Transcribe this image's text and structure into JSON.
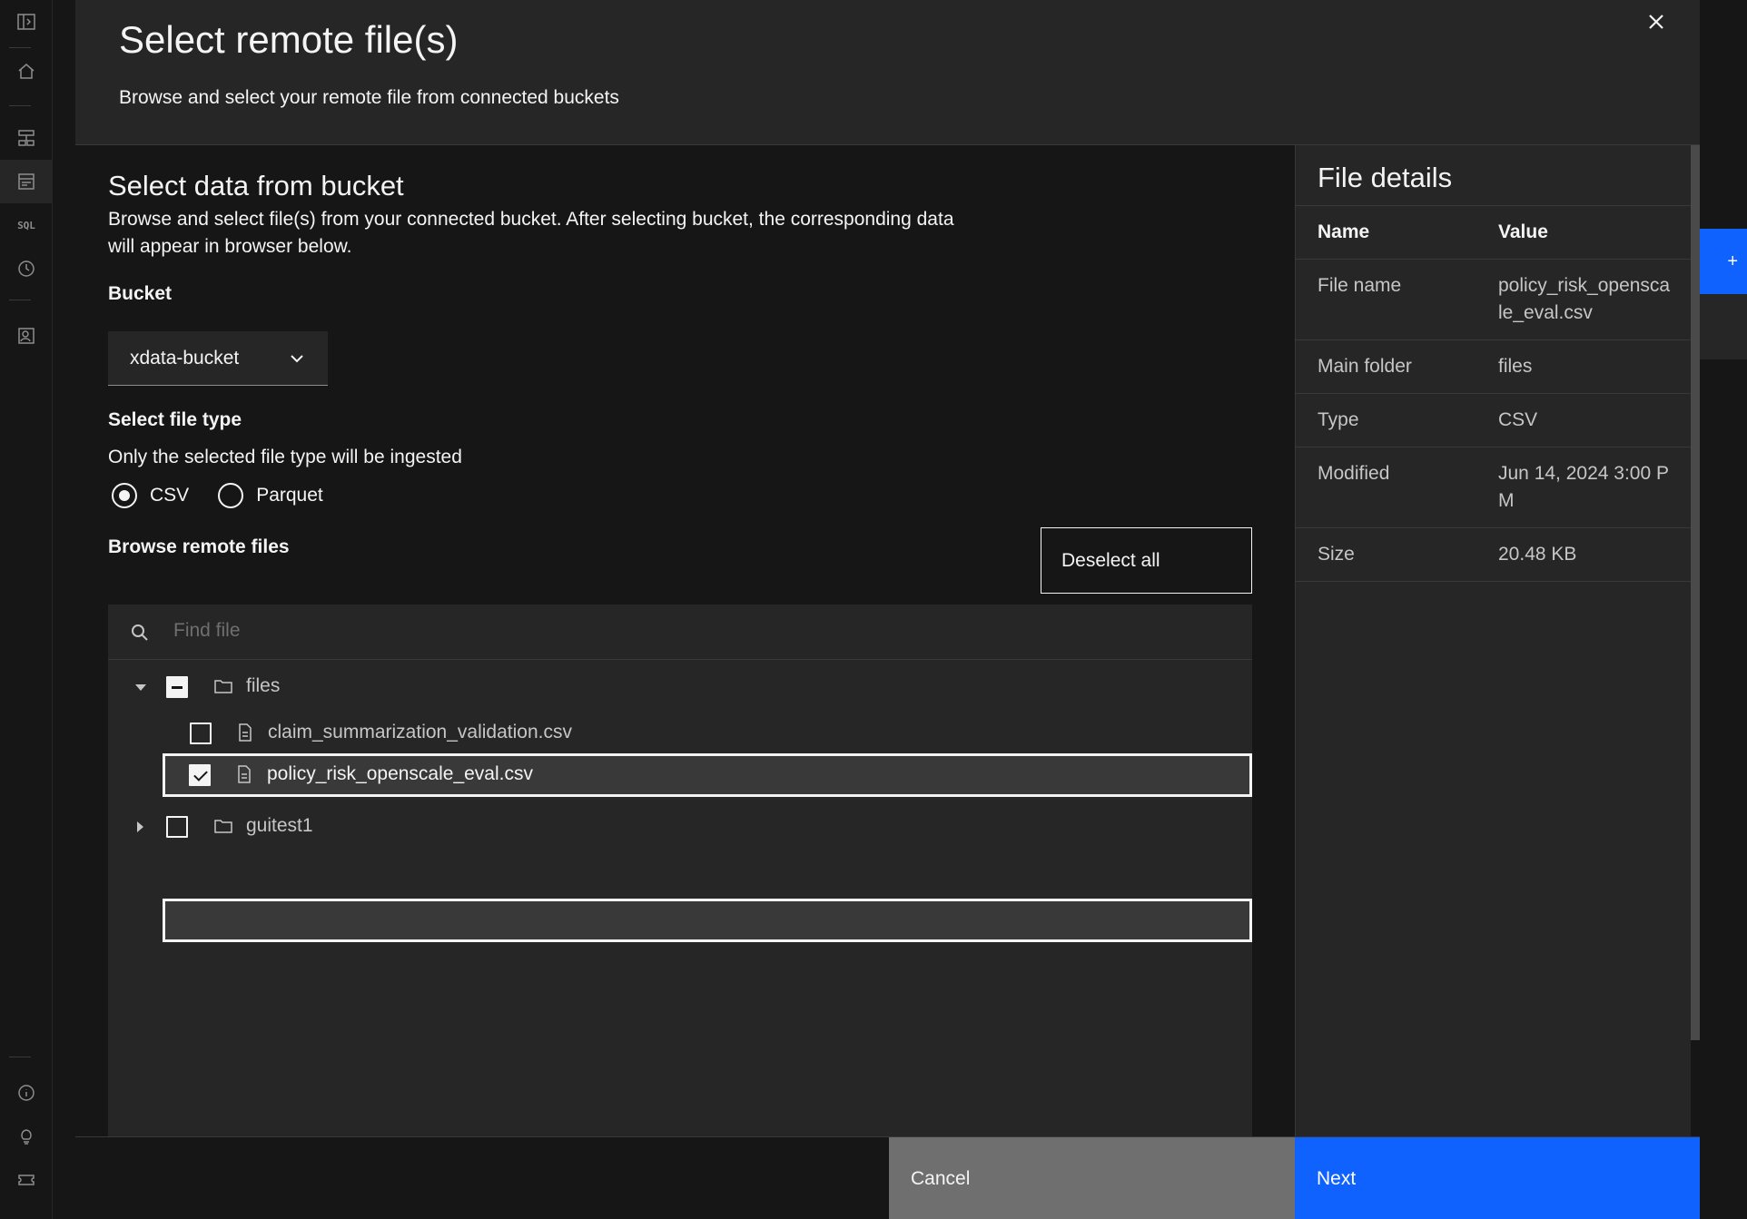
{
  "modal": {
    "title": "Select remote file(s)",
    "subtitle": "Browse and select your remote file from connected buckets"
  },
  "section": {
    "title": "Select data from bucket",
    "description": "Browse and select file(s) from your connected bucket. After selecting bucket, the corresponding data will appear in browser below."
  },
  "bucket": {
    "label": "Bucket",
    "selected": "xdata-bucket"
  },
  "file_type": {
    "label": "Select file type",
    "helper": "Only the selected file type will be ingested",
    "options": [
      {
        "label": "CSV",
        "checked": true
      },
      {
        "label": "Parquet",
        "checked": false
      }
    ]
  },
  "browser": {
    "label": "Browse remote files",
    "deselect_label": "Deselect all",
    "search_placeholder": "Find file",
    "tree": [
      {
        "label": "files",
        "type": "folder",
        "expanded": true,
        "state": "indeterminate"
      },
      {
        "label": "claim_summarization_validation.csv",
        "type": "file",
        "state": "unchecked"
      },
      {
        "label": "policy_risk_openscale_eval.csv",
        "type": "file",
        "state": "checked",
        "selected": true
      },
      {
        "label": "guitest1",
        "type": "folder",
        "expanded": false,
        "state": "unchecked"
      }
    ]
  },
  "details": {
    "title": "File details",
    "header": {
      "name": "Name",
      "value": "Value"
    },
    "rows": [
      {
        "name": "File name",
        "value": "policy_risk_openscale_eval.csv"
      },
      {
        "name": "Main folder",
        "value": "files"
      },
      {
        "name": "Type",
        "value": "CSV"
      },
      {
        "name": "Modified",
        "value": "Jun 14, 2024 3:00 PM"
      },
      {
        "name": "Size",
        "value": "20.48 KB"
      }
    ]
  },
  "footer": {
    "cancel_label": "Cancel",
    "next_label": "Next"
  },
  "rail": {
    "sql_label": "SQL"
  },
  "background": {
    "add_label": "+"
  },
  "colors": {
    "primary": "#0f62fe",
    "background": "#161616",
    "layer": "#262626"
  }
}
